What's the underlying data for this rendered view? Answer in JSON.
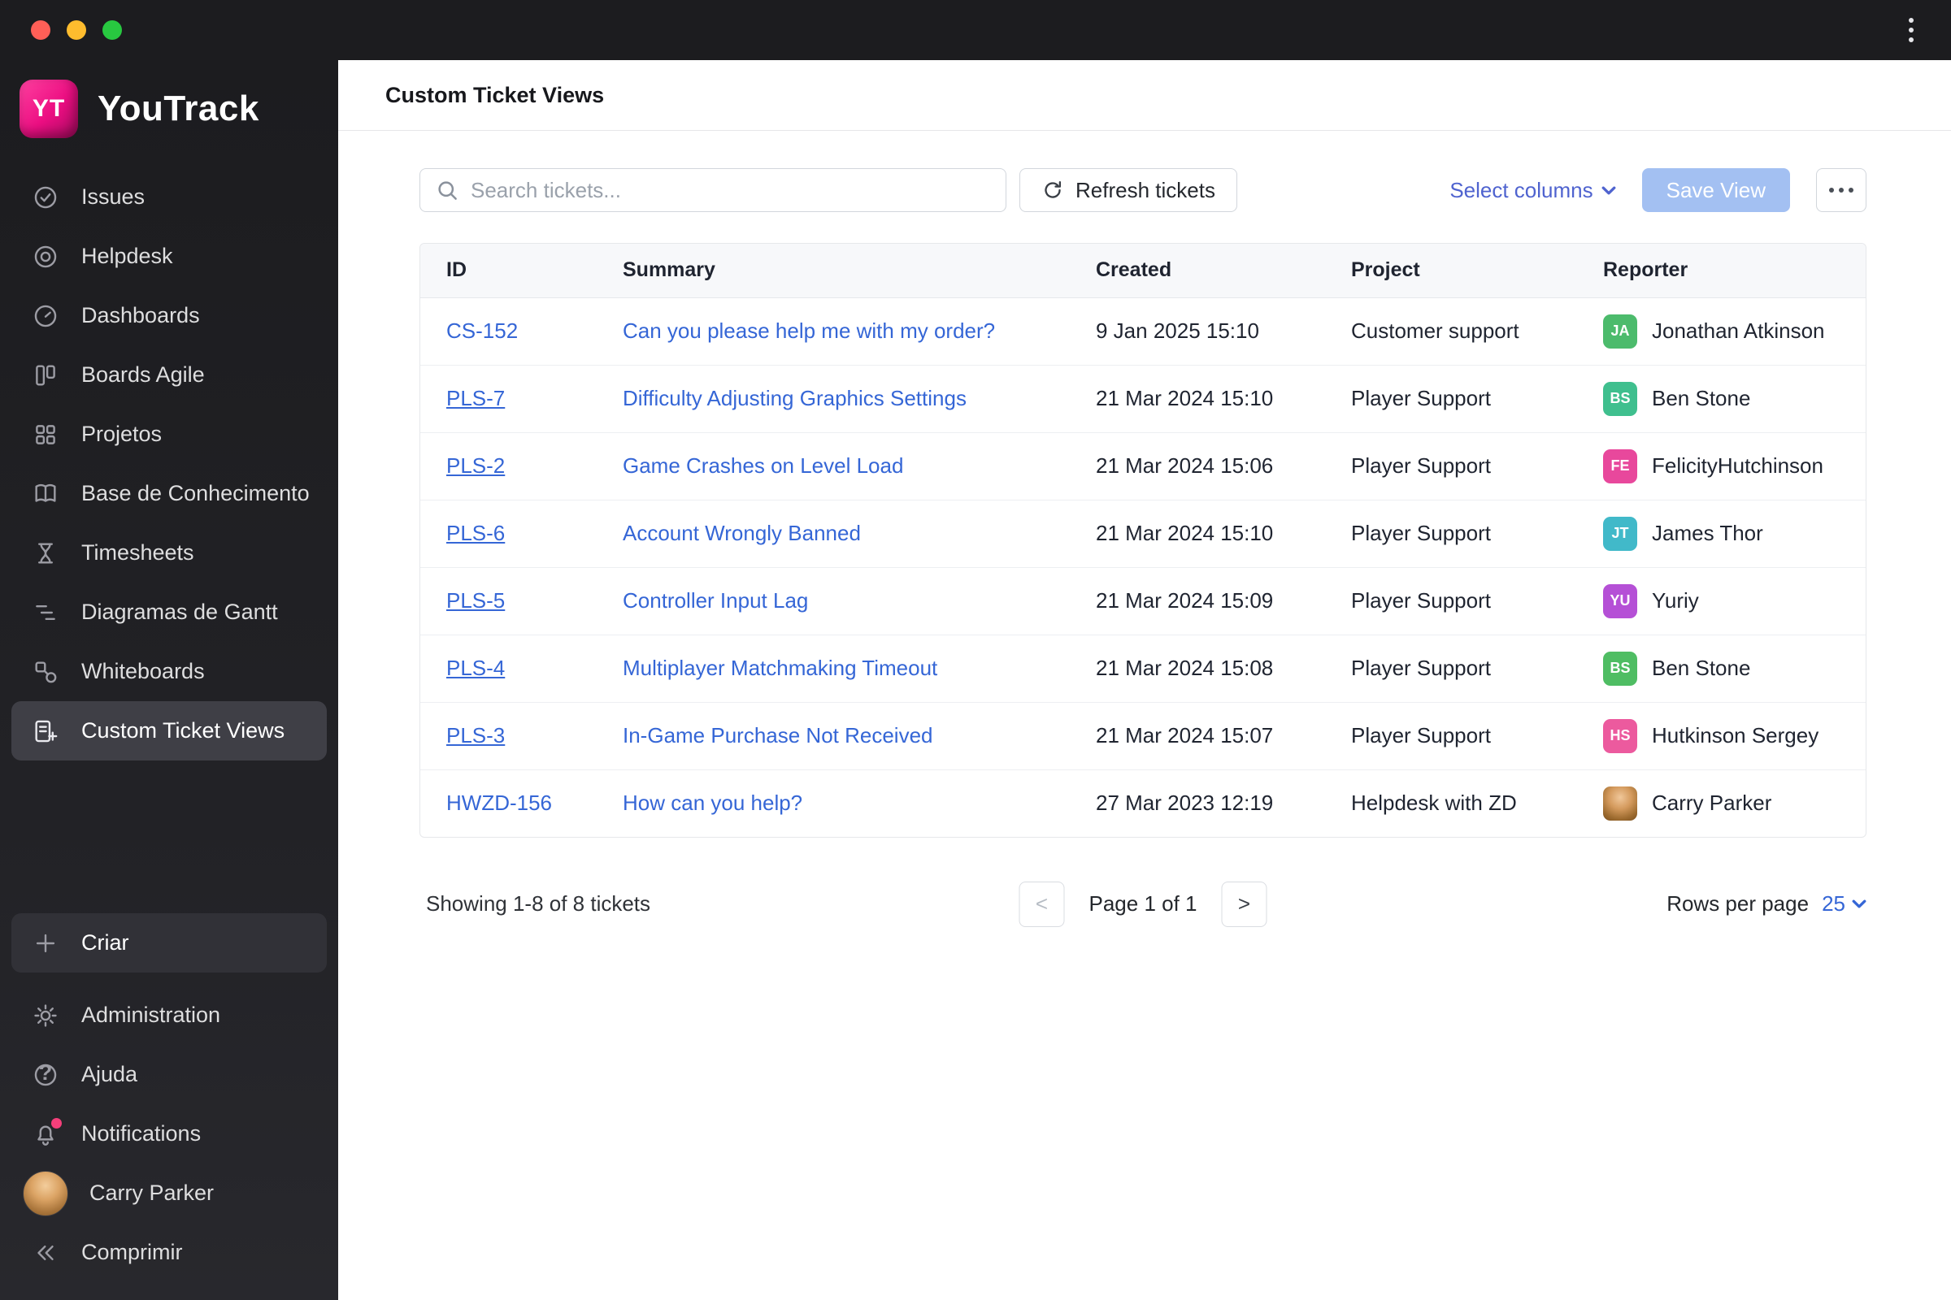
{
  "window": {
    "traffic_lights": [
      "close",
      "minimize",
      "zoom"
    ],
    "kebab_menu": "more-options"
  },
  "colors": {
    "brand_pink": "#ec0e82",
    "link_blue": "#3566d6",
    "select_columns_blue": "#4f63cf",
    "save_view_bg": "#a3c0f2",
    "sidebar_bg": "#1c1c1f",
    "selected_item_bg": "#3f3f46"
  },
  "sidebar": {
    "logo_badge": "YT",
    "logo_text": "YouTrack",
    "items": [
      {
        "label": "Issues"
      },
      {
        "label": "Helpdesk"
      },
      {
        "label": "Dashboards"
      },
      {
        "label": "Boards Agile"
      },
      {
        "label": "Projetos"
      },
      {
        "label": "Base de Conhecimento"
      },
      {
        "label": "Timesheets"
      },
      {
        "label": "Diagramas de Gantt"
      },
      {
        "label": "Whiteboards"
      },
      {
        "label": "Custom Ticket Views",
        "selected": true
      }
    ],
    "create_label": "Criar",
    "bottom_items": [
      {
        "label": "Administration"
      },
      {
        "label": "Ajuda"
      },
      {
        "label": "Notifications"
      },
      {
        "label": "Carry Parker"
      },
      {
        "label": "Comprimir"
      }
    ]
  },
  "header": {
    "title": "Custom Ticket Views"
  },
  "toolbar": {
    "search_placeholder": "Search tickets...",
    "refresh_label": "Refresh tickets",
    "select_columns_label": "Select columns",
    "save_view_label": "Save View"
  },
  "table": {
    "columns": [
      "ID",
      "Summary",
      "Created",
      "Project",
      "Reporter"
    ],
    "rows": [
      {
        "id": "CS-152",
        "summary": "Can you please help me with my order?",
        "created": "9 Jan 2025 15:10",
        "project": "Customer support",
        "reporter": "Jonathan Atkinson",
        "initials": "JA",
        "avatar_color": "#4cbb6c"
      },
      {
        "id": "PLS-7",
        "summary": "Difficulty Adjusting Graphics Settings",
        "created": "21 Mar 2024 15:10",
        "project": "Player Support",
        "reporter": "Ben Stone",
        "initials": "BS",
        "avatar_color": "#3fbf8e"
      },
      {
        "id": "PLS-2",
        "summary": "Game Crashes on Level Load",
        "created": "21 Mar 2024 15:06",
        "project": "Player Support",
        "reporter": "FelicityHutchinson",
        "initials": "FE",
        "avatar_color": "#e8489c"
      },
      {
        "id": "PLS-6",
        "summary": "Account Wrongly Banned",
        "created": "21 Mar 2024 15:10",
        "project": "Player Support",
        "reporter": "James Thor",
        "initials": "JT",
        "avatar_color": "#41b9c9"
      },
      {
        "id": "PLS-5",
        "summary": "Controller Input Lag",
        "created": "21 Mar 2024 15:09",
        "project": "Player Support",
        "reporter": "Yuriy",
        "initials": "YU",
        "avatar_color": "#b550d6"
      },
      {
        "id": "PLS-4",
        "summary": "Multiplayer Matchmaking Timeout",
        "created": "21 Mar 2024 15:08",
        "project": "Player Support",
        "reporter": "Ben Stone",
        "initials": "BS",
        "avatar_color": "#4fbd63"
      },
      {
        "id": "PLS-3",
        "summary": "In-Game Purchase Not Received",
        "created": "21 Mar 2024 15:07",
        "project": "Player Support",
        "reporter": "Hutkinson Sergey",
        "initials": "HS",
        "avatar_color": "#ec5a9e"
      },
      {
        "id": "HWZD-156",
        "summary": "How can you help?",
        "created": "27 Mar 2023 12:19",
        "project": "Helpdesk with ZD",
        "reporter": "Carry Parker",
        "initials": "",
        "avatar_color": "",
        "photo": true
      }
    ]
  },
  "footer": {
    "showing": "Showing 1-8 of 8 tickets",
    "prev_label": "<",
    "page_label": "Page 1 of 1",
    "next_label": ">",
    "rows_per_page_label": "Rows per page",
    "rows_per_page_value": "25"
  }
}
